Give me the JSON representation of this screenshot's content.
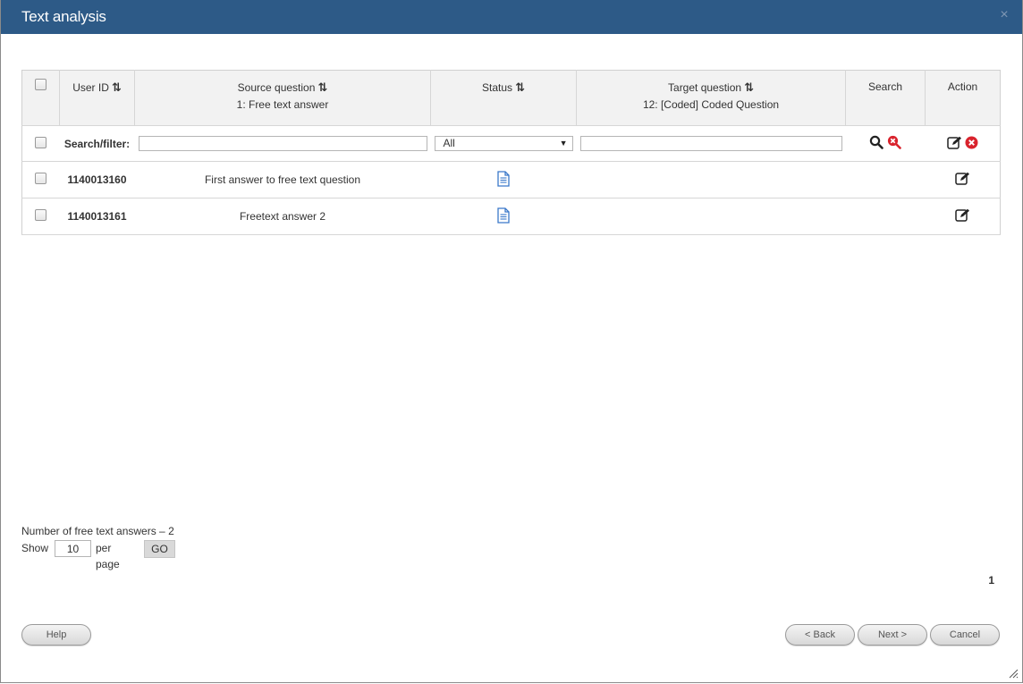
{
  "window": {
    "title": "Text analysis",
    "close_glyph": "×"
  },
  "table": {
    "headers": {
      "user_id": "User ID",
      "source_question": "Source question",
      "source_question_sub": "1: Free text answer",
      "status": "Status",
      "target_question": "Target question",
      "target_question_sub": "12: [Coded] Coded Question",
      "search": "Search",
      "action": "Action",
      "sort_glyph": "⇅"
    },
    "filter": {
      "label": "Search/filter:",
      "source_value": "",
      "status_value": "All",
      "target_value": ""
    },
    "rows": [
      {
        "user_id": "1140013160",
        "source_answer": "First answer to free text question",
        "status_icon": "document-icon"
      },
      {
        "user_id": "1140013161",
        "source_answer": "Freetext answer 2",
        "status_icon": "document-icon"
      }
    ]
  },
  "footer": {
    "count_text": "Number of free text answers – 2",
    "show_label": "Show",
    "per_page_value": "10",
    "per_page_label": "per page",
    "go_label": "GO",
    "page_number": "1"
  },
  "buttons": {
    "help": "Help",
    "back": "< Back",
    "next": "Next >",
    "cancel": "Cancel"
  },
  "colors": {
    "titlebar": "#2d5a87",
    "doc_icon": "#3a78c9",
    "clear_icon": "#d9232d"
  }
}
